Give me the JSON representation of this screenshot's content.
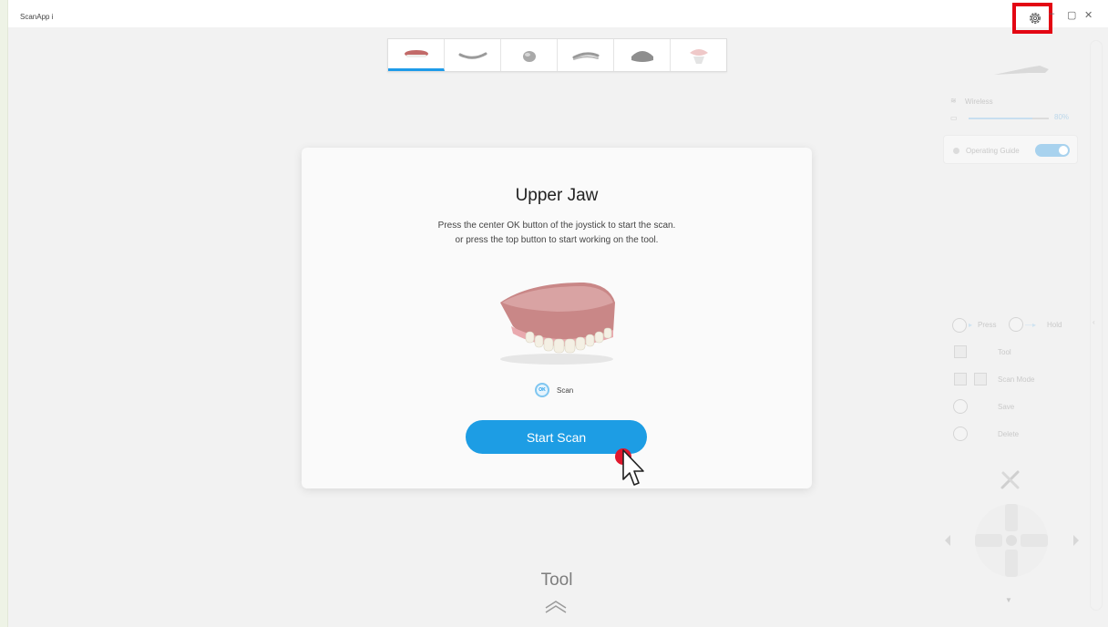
{
  "app": {
    "title": "ScanApp i"
  },
  "window_controls": {
    "restore": "▢",
    "close": "✕"
  },
  "scan_modes": [
    {
      "name": "upper-jaw",
      "active": true
    },
    {
      "name": "lower-jaw",
      "active": false
    },
    {
      "name": "die",
      "active": false
    },
    {
      "name": "bite",
      "active": false
    },
    {
      "name": "impression",
      "active": false
    },
    {
      "name": "model",
      "active": false
    }
  ],
  "side_panel": {
    "wireless_label": "Wireless",
    "battery_percent": "80%",
    "battery_level": 0.8,
    "operating_guide_label": "Operating Guide",
    "operating_guide_on": true,
    "press_label": "Press",
    "hold_label": "Hold",
    "tool_label": "Tool",
    "scan_mode_label": "Scan Mode",
    "save_label": "Save",
    "delete_label": "Delete"
  },
  "card": {
    "title": "Upper Jaw",
    "line1": "Press the center OK button of the joystick to start the scan.",
    "line2": "or press the top button to start working on the tool.",
    "ok_icon_text": "OK",
    "scan_hint": "Scan",
    "start_button": "Start Scan"
  },
  "bottom": {
    "tool_label": "Tool"
  },
  "colors": {
    "accent": "#1d9de4",
    "highlight": "#e30613"
  }
}
